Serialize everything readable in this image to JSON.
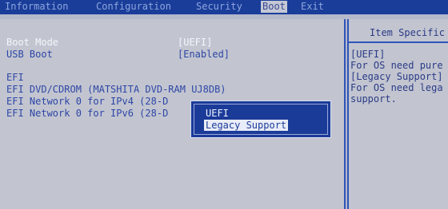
{
  "menu": {
    "tabs": [
      {
        "label": "Information",
        "active": false
      },
      {
        "label": "Configuration",
        "active": false
      },
      {
        "label": "Security",
        "active": false
      },
      {
        "label": "Boot",
        "active": true
      },
      {
        "label": "Exit",
        "active": false
      }
    ]
  },
  "boot": {
    "boot_mode_label": "Boot Mode",
    "boot_mode_value": "[UEFI]",
    "usb_boot_label": "USB Boot",
    "usb_boot_value": "[Enabled]",
    "efi_header": "EFI",
    "devices": [
      "EFI DVD/CDROM (MATSHITA DVD-RAM UJ8DB)",
      "EFI Network 0 for IPv4 (28-D",
      "EFI Network 0 for IPv6 (28-D"
    ]
  },
  "popup": {
    "options": [
      "UEFI",
      "Legacy Support"
    ],
    "selected_index": 1
  },
  "help": {
    "title": "Item Specific",
    "lines": [
      "[UEFI]",
      "For OS need pure",
      "[Legacy Support]",
      "For OS need lega",
      "support."
    ]
  },
  "colors": {
    "menu_bar": "#1a3d9a",
    "panel": "#c2c5d0",
    "text_blue": "#2e46a6",
    "popup": "#1b3b99"
  }
}
